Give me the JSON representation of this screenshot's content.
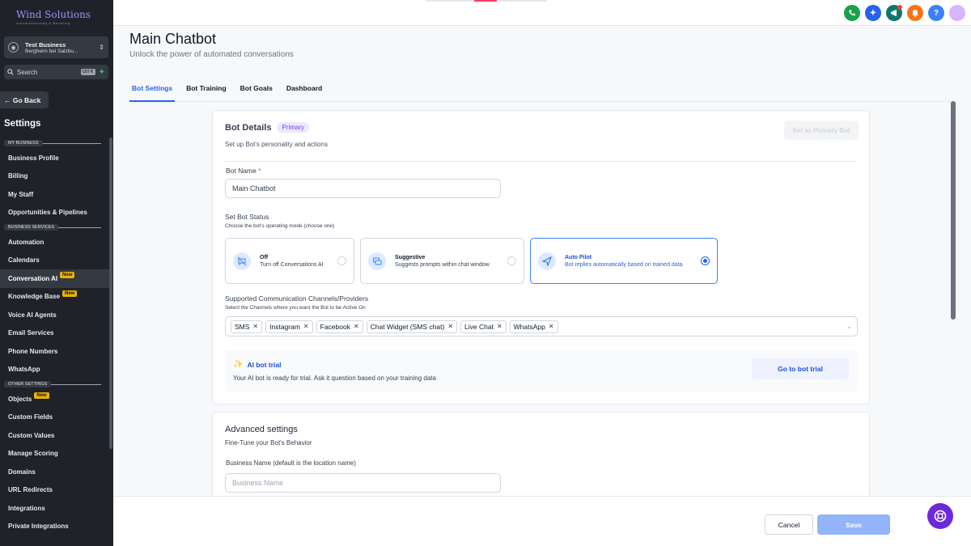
{
  "sidebar": {
    "logo": "Wind Solutions",
    "logo_tagline": "Automatisierung & Beratung",
    "business": {
      "name": "Test Business",
      "location": "Bergheim bei Salzbu..."
    },
    "search": {
      "placeholder": "Search",
      "shortcut": "ctrl K"
    },
    "go_back": "Go Back",
    "title": "Settings",
    "sections": {
      "my_business": "MY BUSINESS",
      "business_services": "BUSINESS SERVICES",
      "other_settings": "OTHER SETTINGS"
    },
    "items": {
      "business_profile": "Business Profile",
      "billing": "Billing",
      "my_staff": "My Staff",
      "opportunities": "Opportunities & Pipelines",
      "automation": "Automation",
      "calendars": "Calendars",
      "conversation_ai": "Conversation AI",
      "knowledge_base": "Knowledge Base",
      "voice_ai": "Voice AI Agents",
      "email_services": "Email Services",
      "phone_numbers": "Phone Numbers",
      "whatsapp": "WhatsApp",
      "objects": "Objects",
      "custom_fields": "Custom Fields",
      "custom_values": "Custom Values",
      "manage_scoring": "Manage Scoring",
      "domains": "Domains",
      "url_redirects": "URL Redirects",
      "integrations": "Integrations",
      "private_integrations": "Private Integrations"
    },
    "new_badge": "New"
  },
  "header": {
    "title": "Main Chatbot",
    "subtitle": "Unlock the power of automated conversations",
    "tabs": [
      "Bot Settings",
      "Bot Training",
      "Bot Goals",
      "Dashboard"
    ]
  },
  "bot_details": {
    "title": "Bot Details",
    "badge": "Primary",
    "description": "Set up Bot's personality and actions",
    "set_primary_button": "Set as Primary Bot",
    "bot_name_label": "Bot Name",
    "required_mark": "*",
    "bot_name_value": "Main Chatbot",
    "status_label": "Set Bot Status",
    "status_hint": "Choose the bot's operating mode (choose one)",
    "modes": [
      {
        "title": "Off",
        "desc": "Turn off Conversations AI"
      },
      {
        "title": "Suggestive",
        "desc": "Suggests prompts within chat window"
      },
      {
        "title": "Auto Pilot",
        "desc": "Bot replies automatically based on trained data"
      }
    ],
    "channels_label": "Supported Communication Channels/Providers",
    "channels_hint": "Select the Channels where you want the Bot to be Active On",
    "channels": [
      "SMS",
      "Instagram",
      "Facebook",
      "Chat Widget (SMS chat)",
      "Live Chat",
      "WhatsApp"
    ],
    "trial_title": "AI bot trial",
    "trial_desc": "Your AI bot is ready for trial. Ask it question based on your training data",
    "trial_button": "Go to bot trial"
  },
  "advanced": {
    "title": "Advanced settings",
    "subtitle": "Fine-Tune your Bot's Behavior",
    "business_name_label": "Business Name (default is the location name)",
    "business_name_placeholder": "Business Name"
  },
  "footer": {
    "cancel": "Cancel",
    "save": "Save"
  },
  "colors": {
    "accent": "#2563eb",
    "sidebar_bg": "#1f2329",
    "primary_badge": "#7c3aed",
    "help_fab": "#6d28d9"
  }
}
